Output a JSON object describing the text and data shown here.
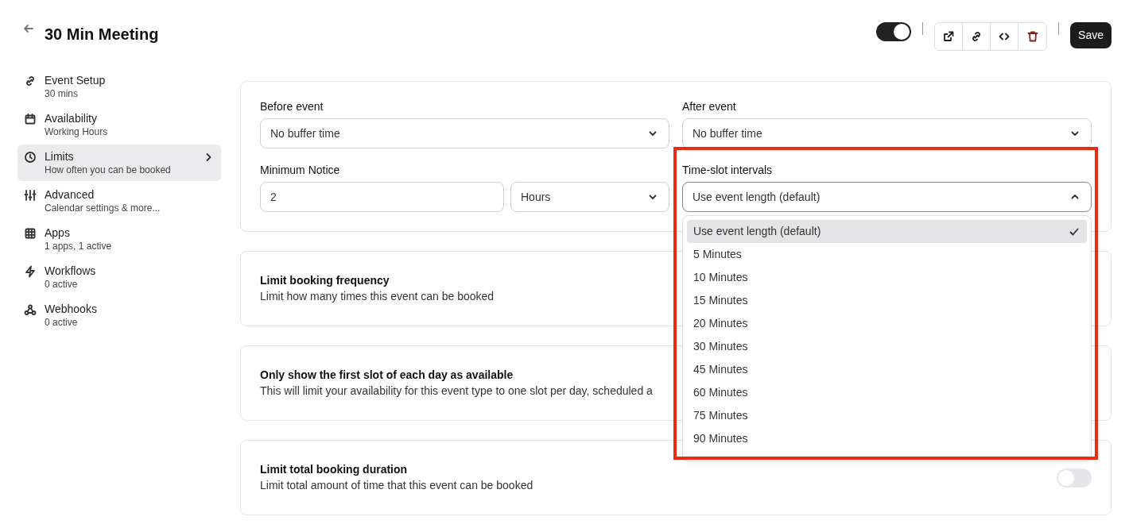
{
  "header": {
    "title": "30 Min Meeting",
    "enabled": true,
    "save_label": "Save"
  },
  "sidebar": {
    "items": [
      {
        "title": "Event Setup",
        "subtitle": "30 mins",
        "selected": false
      },
      {
        "title": "Availability",
        "subtitle": "Working Hours",
        "selected": false
      },
      {
        "title": "Limits",
        "subtitle": "How often you can be booked",
        "selected": true
      },
      {
        "title": "Advanced",
        "subtitle": "Calendar settings & more...",
        "selected": false
      },
      {
        "title": "Apps",
        "subtitle": "1 apps, 1 active",
        "selected": false
      },
      {
        "title": "Workflows",
        "subtitle": "0 active",
        "selected": false
      },
      {
        "title": "Webhooks",
        "subtitle": "0 active",
        "selected": false
      }
    ]
  },
  "buffers": {
    "before_event": {
      "label": "Before event",
      "value": "No buffer time"
    },
    "after_event": {
      "label": "After event",
      "value": "No buffer time"
    },
    "minimum_notice": {
      "label": "Minimum Notice",
      "value": "2",
      "unit": "Hours"
    },
    "time_slot_intervals": {
      "label": "Time-slot intervals",
      "value": "Use event length (default)",
      "expanded": true,
      "options": [
        {
          "label": "Use event length (default)",
          "selected": true
        },
        {
          "label": "5 Minutes",
          "selected": false
        },
        {
          "label": "10 Minutes",
          "selected": false
        },
        {
          "label": "15 Minutes",
          "selected": false
        },
        {
          "label": "20 Minutes",
          "selected": false
        },
        {
          "label": "30 Minutes",
          "selected": false
        },
        {
          "label": "45 Minutes",
          "selected": false
        },
        {
          "label": "60 Minutes",
          "selected": false
        },
        {
          "label": "75 Minutes",
          "selected": false
        },
        {
          "label": "90 Minutes",
          "selected": false
        }
      ]
    }
  },
  "settings": [
    {
      "title": "Limit booking frequency",
      "description": "Limit how many times this event can be booked"
    },
    {
      "title": "Only show the first slot of each day as available",
      "description": "This will limit your availability for this event type to one slot per day, scheduled a"
    },
    {
      "title": "Limit total booking duration",
      "description": "Limit total amount of time that this event can be booked",
      "on": false
    }
  ]
}
